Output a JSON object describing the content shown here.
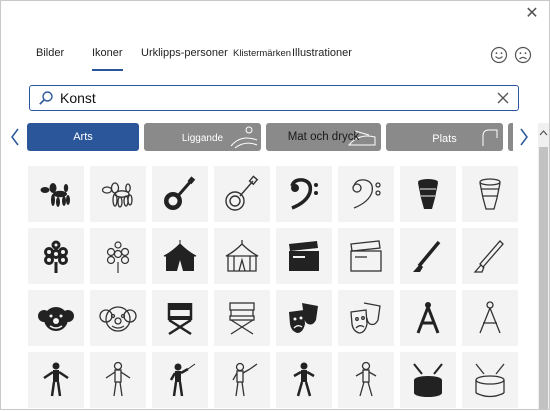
{
  "window": {
    "close_label": "✕"
  },
  "tabs": [
    {
      "label": "Bilder",
      "active": false
    },
    {
      "label": "Ikoner",
      "active": true
    },
    {
      "label": "Urklipps-personer",
      "active": false
    },
    {
      "label": "Klistermärken",
      "active": false
    },
    {
      "label": "Illustrationer",
      "active": false
    }
  ],
  "feedback": {
    "happy_icon": "smiley-happy-icon",
    "sad_icon": "smiley-sad-icon"
  },
  "search": {
    "value": "Konst",
    "placeholder": ""
  },
  "categories": [
    {
      "label": "Arts",
      "selected": true,
      "color": "#2b579a"
    },
    {
      "label": "Liggande",
      "selected": false,
      "color": "#8a8a8a"
    },
    {
      "label": "Mat och dryck",
      "selected": false,
      "color": "#8a8a8a"
    },
    {
      "label": "Plats",
      "selected": false,
      "color": "#8a8a8a"
    }
  ],
  "icons": [
    [
      "balloon-dog-filled-icon",
      "balloon-dog-outline-icon",
      "banjo-filled-icon",
      "banjo-outline-icon",
      "bass-clef-filled-icon",
      "bass-clef-outline-icon",
      "drum-filled-icon",
      "drum-outline-icon"
    ],
    [
      "chinese-knot-filled-icon",
      "chinese-knot-outline-icon",
      "circus-tent-filled-icon",
      "circus-tent-outline-icon",
      "clapperboard-filled-icon",
      "clapperboard-outline-icon",
      "clarinet-filled-icon",
      "clarinet-outline-icon"
    ],
    [
      "clown-filled-icon",
      "clown-outline-icon",
      "directors-chair-filled-icon",
      "directors-chair-outline-icon",
      "theater-masks-filled-icon",
      "theater-masks-outline-icon",
      "compass-filled-icon",
      "compass-outline-icon"
    ],
    [
      "mannequin-filled-icon",
      "mannequin-outline-icon",
      "conductor-filled-icon",
      "conductor-outline-icon",
      "dancer-filled-icon",
      "dancer-outline-icon",
      "snare-drum-filled-icon",
      "snare-drum-outline-icon"
    ]
  ]
}
